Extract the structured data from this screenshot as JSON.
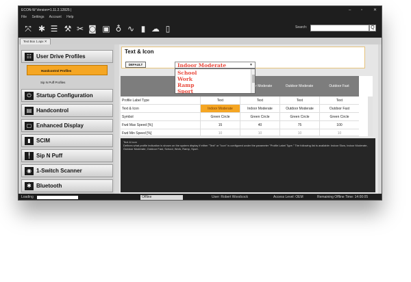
{
  "window": {
    "title": "ECON-W  Version=1.11.2.12825 |",
    "controls": [
      "–",
      "▫",
      "✕"
    ]
  },
  "menu": [
    "File",
    "Settings",
    "Account",
    "Help"
  ],
  "toolbar": {
    "icons": [
      "no-signal-icon",
      "no-bluetooth-icon",
      "list-icon",
      "wrench-icon",
      "tools-crossed-icon",
      "camera-icon",
      "monitor-icon",
      "stethoscope-icon",
      "waveform-icon",
      "battery-icon",
      "cloud-icon",
      "info-box-icon"
    ],
    "search_label": "Search:",
    "search_value": "",
    "search_button": "Q"
  },
  "tab": {
    "label": "Text Box 1.apx",
    "close": "✕"
  },
  "sidebar": {
    "items": [
      {
        "label": "User Drive Profiles",
        "icon": "sliders-icon"
      },
      {
        "label": "Startup Configuration",
        "icon": "power-icon"
      },
      {
        "label": "Handcontrol",
        "icon": "joystick-icon"
      },
      {
        "label": "Enhanced Display",
        "icon": "display-icon"
      },
      {
        "label": "SCIM",
        "icon": "scim-icon"
      },
      {
        "label": "Sip N Puff",
        "icon": "sip-puff-icon"
      },
      {
        "label": "1-Switch Scanner",
        "icon": "switch-scanner-icon"
      },
      {
        "label": "Bluetooth",
        "icon": "bluetooth-icon"
      }
    ],
    "sub_items": [
      {
        "label": "Handcontrol Profiles",
        "active": true
      },
      {
        "label": "Sip N Puff Profiles",
        "active": false
      }
    ]
  },
  "panel": {
    "title": "Text & Icon",
    "default_button": "DEFAULT",
    "dropdown": {
      "value": "Indoor Moderate",
      "options": [
        "School",
        "Work",
        "Ramp",
        "Sport"
      ]
    }
  },
  "grid": {
    "columns": [
      "Indoor Moderate",
      "Outdoor Moderate",
      "Outdoor Fast"
    ],
    "rows": [
      {
        "label": "Profile Label Type",
        "cells": [
          "Text",
          "Text",
          "Text",
          "Text"
        ],
        "highlight": false
      },
      {
        "label": "Text & Icon",
        "cells": [
          "Indoor Moderate",
          "Indoor Moderate",
          "Outdoor Moderate",
          "Outdoor Fast"
        ],
        "highlight": true
      },
      {
        "label": "Symbol",
        "cells": [
          "Green Circle",
          "Green Circle",
          "Green Circle",
          "Green Circle"
        ],
        "highlight": false
      },
      {
        "label": "Fwd Max Speed [%]",
        "cells": [
          "15",
          "40",
          "75",
          "100"
        ],
        "highlight": false
      },
      {
        "label": "Fwd Min Speed [%]",
        "cells": [
          "10",
          "10",
          "10",
          "10"
        ],
        "highlight": false
      }
    ]
  },
  "description": {
    "title": "Text & Icon",
    "body": "Defines what profile indication is shown on the system display if either \"Text\" or \"Icon\" is configured under the parameter \"Profile Label Type.\" The following list is available: Indoor Slow, Indoor Moderate, Outdoor Moderate, Outdoor Fast, School, Work, Ramp, Sport."
  },
  "status": {
    "loading": "Loading",
    "connection": "Offline",
    "user": "User: Robert Woodcock",
    "access": "Access Level:  OEM",
    "remaining": "Remaining Offline Time: 14:00:05"
  },
  "colors": {
    "accent": "#f5a623",
    "dropdown_text": "#e8483b",
    "chrome": "#1e1e1e",
    "grid_header": "#7d7d7d"
  }
}
